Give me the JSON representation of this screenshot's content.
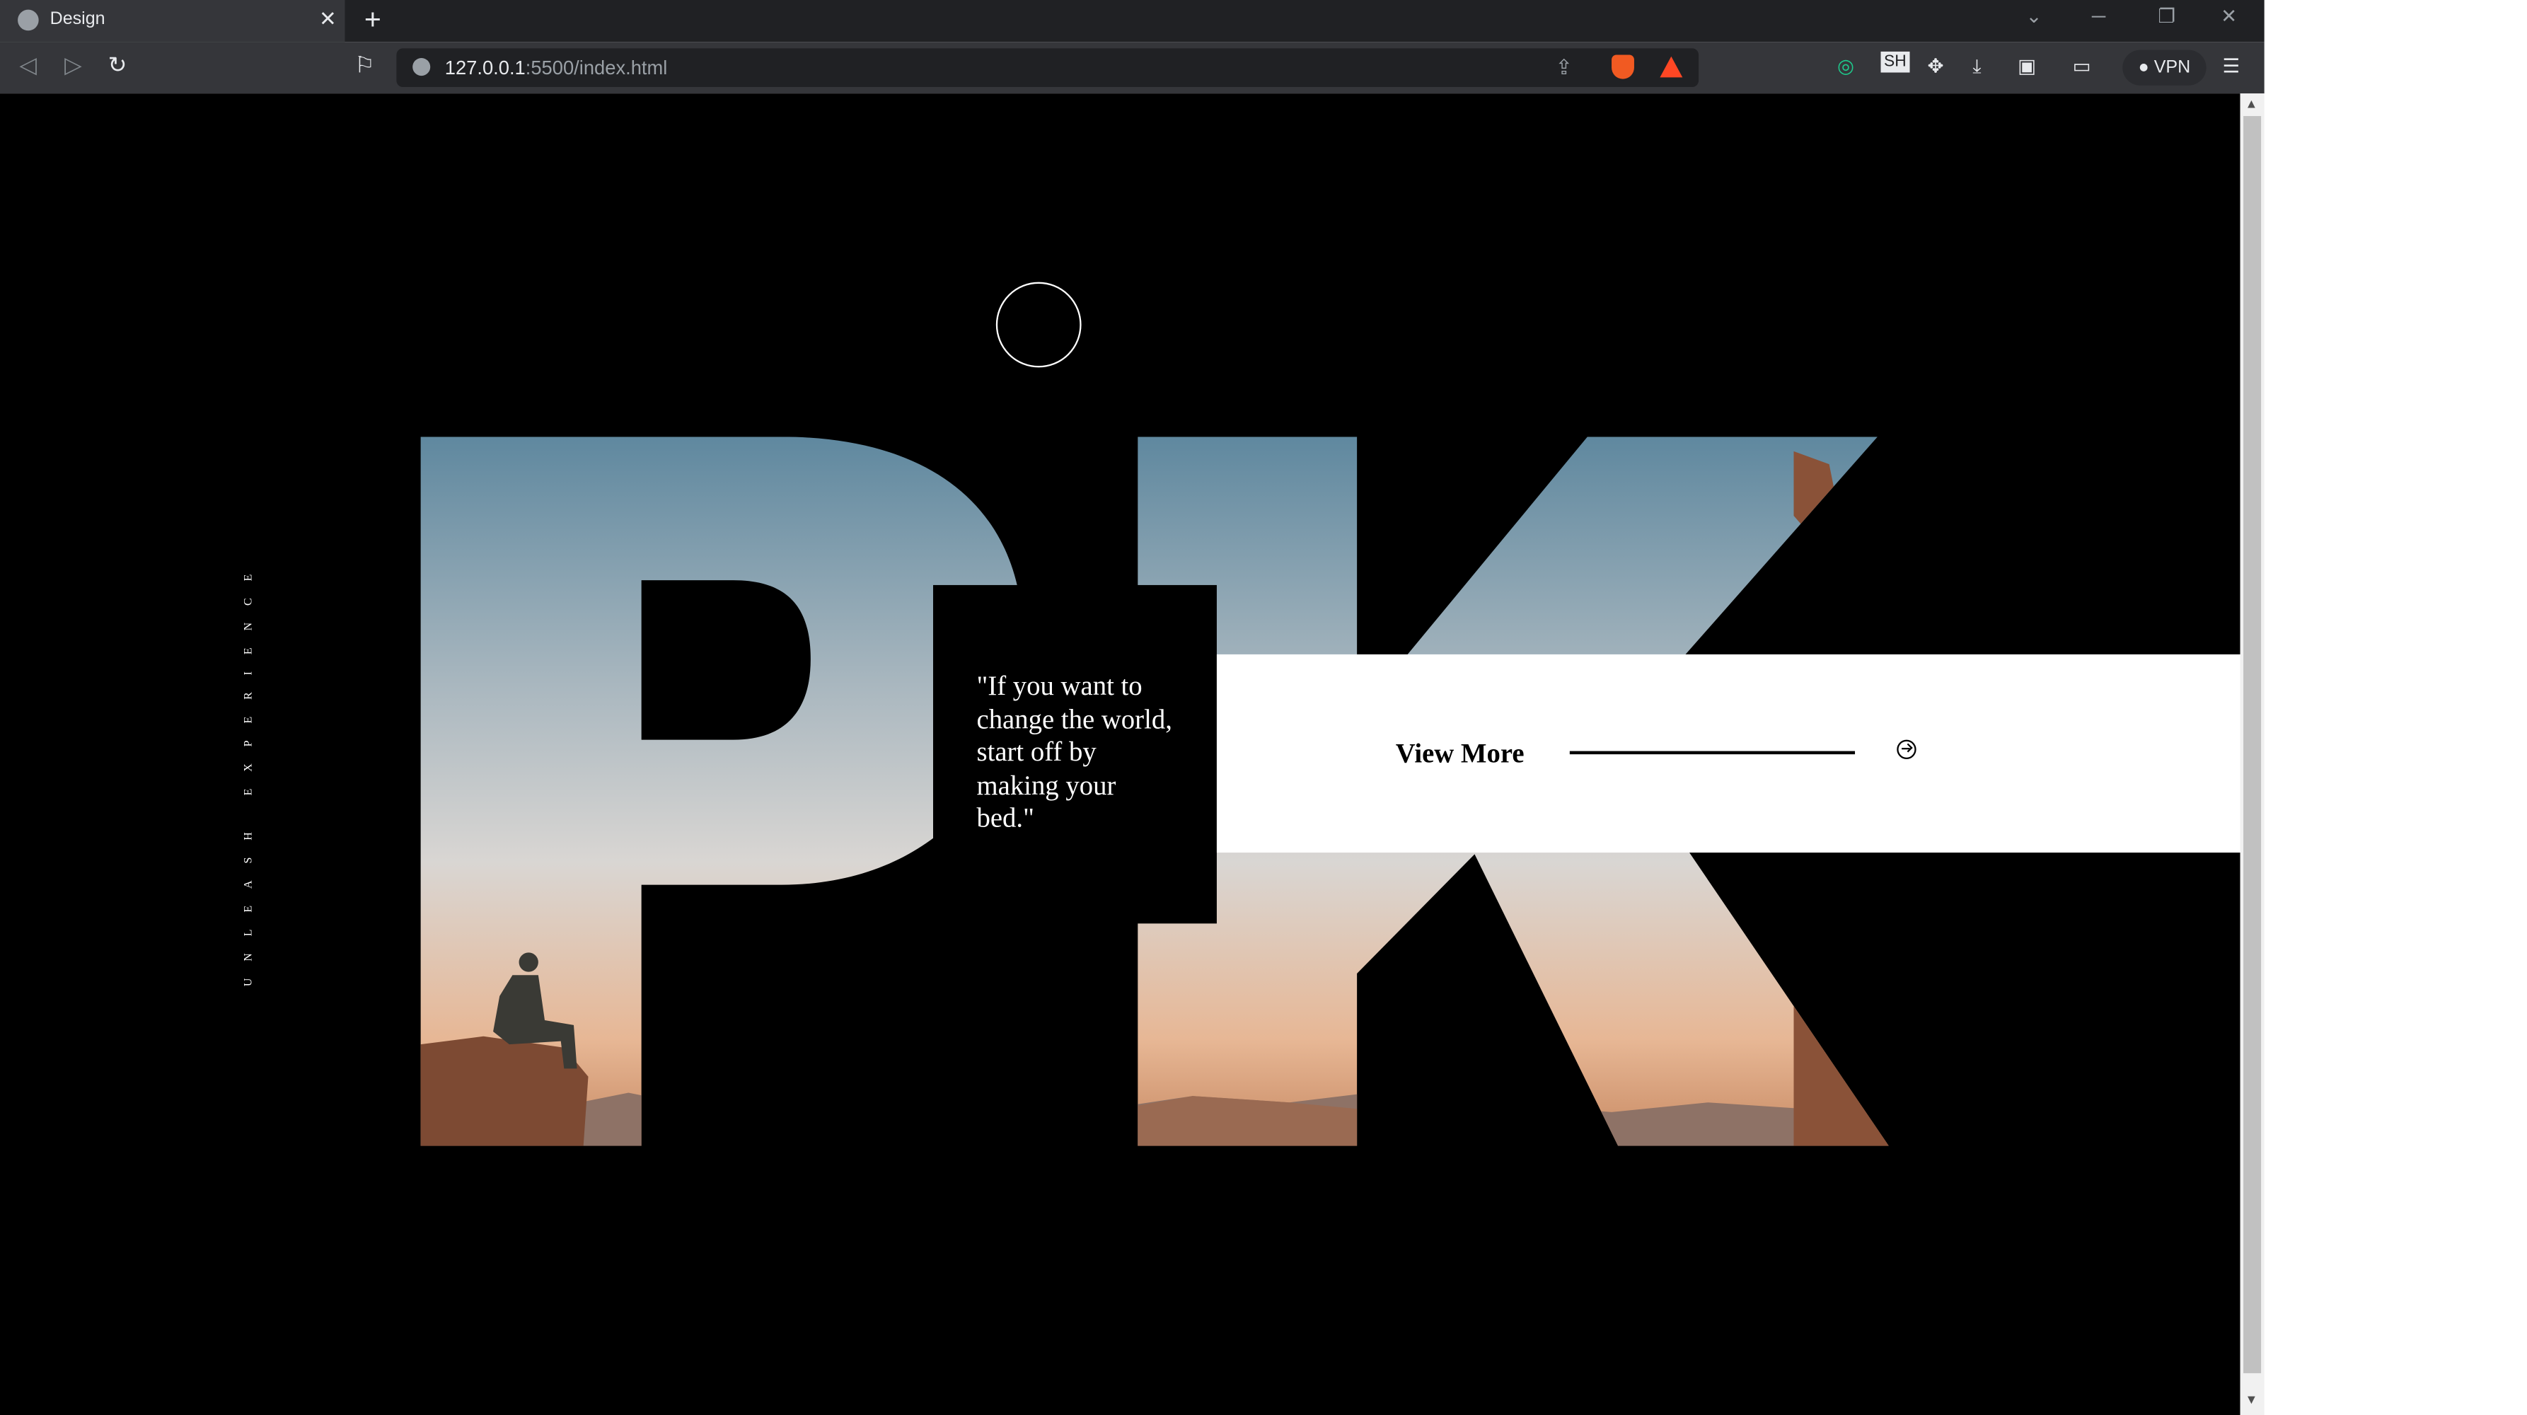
{
  "browser": {
    "tab_title": "Design",
    "tab_close": "✕",
    "new_tab": "+",
    "url_host": "127.0.0.1",
    "url_path": ":5500/index.html",
    "vpn_label": "VPN",
    "extension_label": "SH"
  },
  "page": {
    "vertical_text": "UNLEASH EXPERIENCE",
    "quote": "\"If you want to change the world, start off by making your bed.\"",
    "view_more_label": "View More",
    "hero_letters": "PK"
  },
  "colors": {
    "background": "#000000",
    "band": "#ffffff",
    "sky_top": "#5e87a0",
    "sky_mid": "#cfd5d8",
    "horizon": "#e8a06b",
    "rock": "#8a5238"
  }
}
